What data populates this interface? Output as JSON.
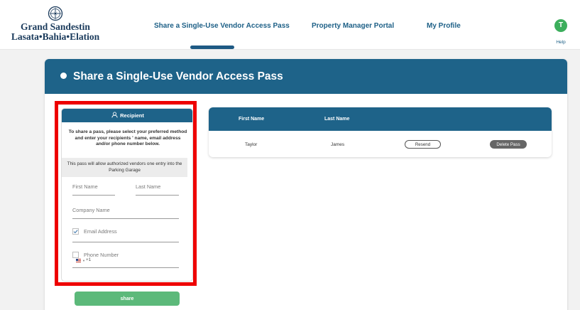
{
  "brand": {
    "line1": "Grand Sandestin",
    "line2": "Lasata•Bahia•Elation",
    "emblem_icon": "compass-rose-icon"
  },
  "nav": {
    "links": [
      "Share a Single-Use Vendor Access Pass",
      "Property Manager Portal",
      "My Profile"
    ],
    "active_index": 0,
    "avatar_initial": "T",
    "help_label": "Help"
  },
  "page": {
    "title": "Share a Single-Use Vendor Access Pass"
  },
  "recipient": {
    "header": "Recipient",
    "header_icon": "user-icon",
    "intro": "To share a pass, please select your preferred method and enter your recipients ' name, email address and/or phone number below.",
    "note": "This pass will allow authorized vendors one entry into the Parking Garage",
    "first_name_placeholder": "First Name",
    "last_name_placeholder": "Last Name",
    "company_placeholder": "Company Name",
    "email_label": "Email Address",
    "email_checked": true,
    "phone_label": "Phone Number",
    "phone_checked": false,
    "country_flag_icon": "us-flag-icon",
    "dial_code": "+1"
  },
  "share_label": "share",
  "passes": {
    "columns": [
      "First Name",
      "Last Name"
    ],
    "rows": [
      {
        "first_name": "Taylor",
        "last_name": "James",
        "resend_label": "Resend",
        "delete_label": "Delete Pass"
      }
    ]
  },
  "colors": {
    "primary": "#1e6389",
    "accent_green": "#5cb97a",
    "avatar_green": "#3cae5c",
    "highlight_red": "#ee0000"
  }
}
